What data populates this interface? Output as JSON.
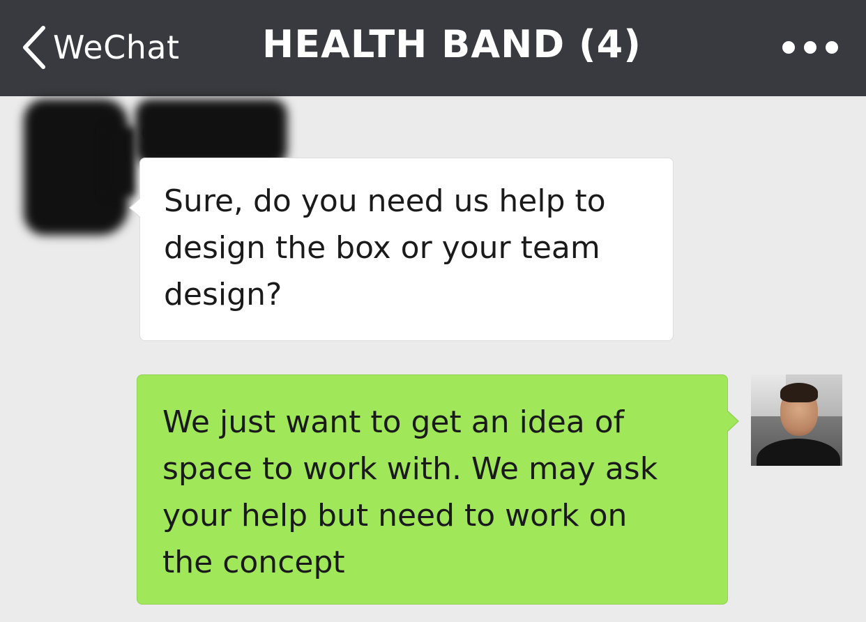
{
  "nav": {
    "back_label": "WeChat",
    "title": "HEALTH BAND (4)",
    "more_icon": "more-horizontal-icon",
    "back_icon": "chevron-left-icon"
  },
  "messages": [
    {
      "direction": "incoming",
      "sender_name": "e",
      "text": "Sure, do you need us help to\ndesign the box or your team\ndesign?",
      "bubble_color": "#ffffff"
    },
    {
      "direction": "outgoing",
      "text": "We just want to get an idea of\nspace to work with. We may ask\nyour help but need to work on\nthe concept",
      "bubble_color": "#a0e75a"
    }
  ],
  "colors": {
    "nav_background": "#393a3f",
    "chat_background": "#ebebeb",
    "incoming_bubble": "#ffffff",
    "outgoing_bubble": "#a0e75a"
  }
}
